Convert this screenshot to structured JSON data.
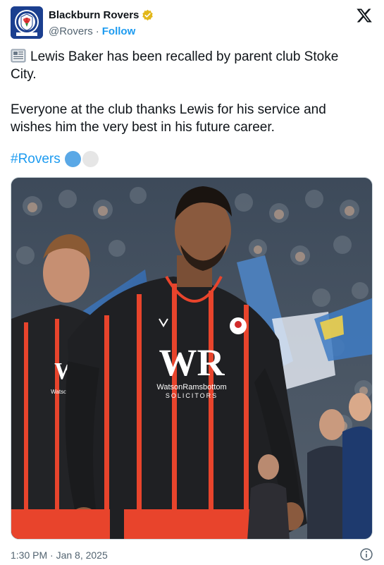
{
  "account": {
    "display_name": "Blackburn Rovers",
    "handle": "@Rovers",
    "separator": "·",
    "follow_label": "Follow",
    "avatar_icon": "blackburn-rovers-crest-icon",
    "verified_icon": "gold-verified-badge-icon",
    "verified_color": "#e2b719"
  },
  "platform": {
    "logo_icon": "x-logo-icon"
  },
  "tweet": {
    "paragraph1": "Lewis Baker has been recalled by parent club Stoke City.",
    "paragraph1_icon": "newspaper-icon",
    "paragraph2": "Everyone at the club thanks Lewis for his service and wishes him the very best in his future career.",
    "hashtag": "#Rovers",
    "emoji_icons": [
      "blue-circle-icon",
      "white-circle-icon"
    ]
  },
  "media": {
    "description_icon": "players-walking-out-photo",
    "shirt_sponsor": "WR",
    "shirt_sponsor_sub": "WatsonRamsbottom",
    "shirt_sponsor_sub2": "SOLICITORS"
  },
  "footer": {
    "timestamp": "1:30 PM · Jan 8, 2025",
    "info_icon": "info-icon"
  },
  "colors": {
    "accent": "#1d9bf0",
    "text": "#0f1419",
    "muted": "#536471"
  }
}
